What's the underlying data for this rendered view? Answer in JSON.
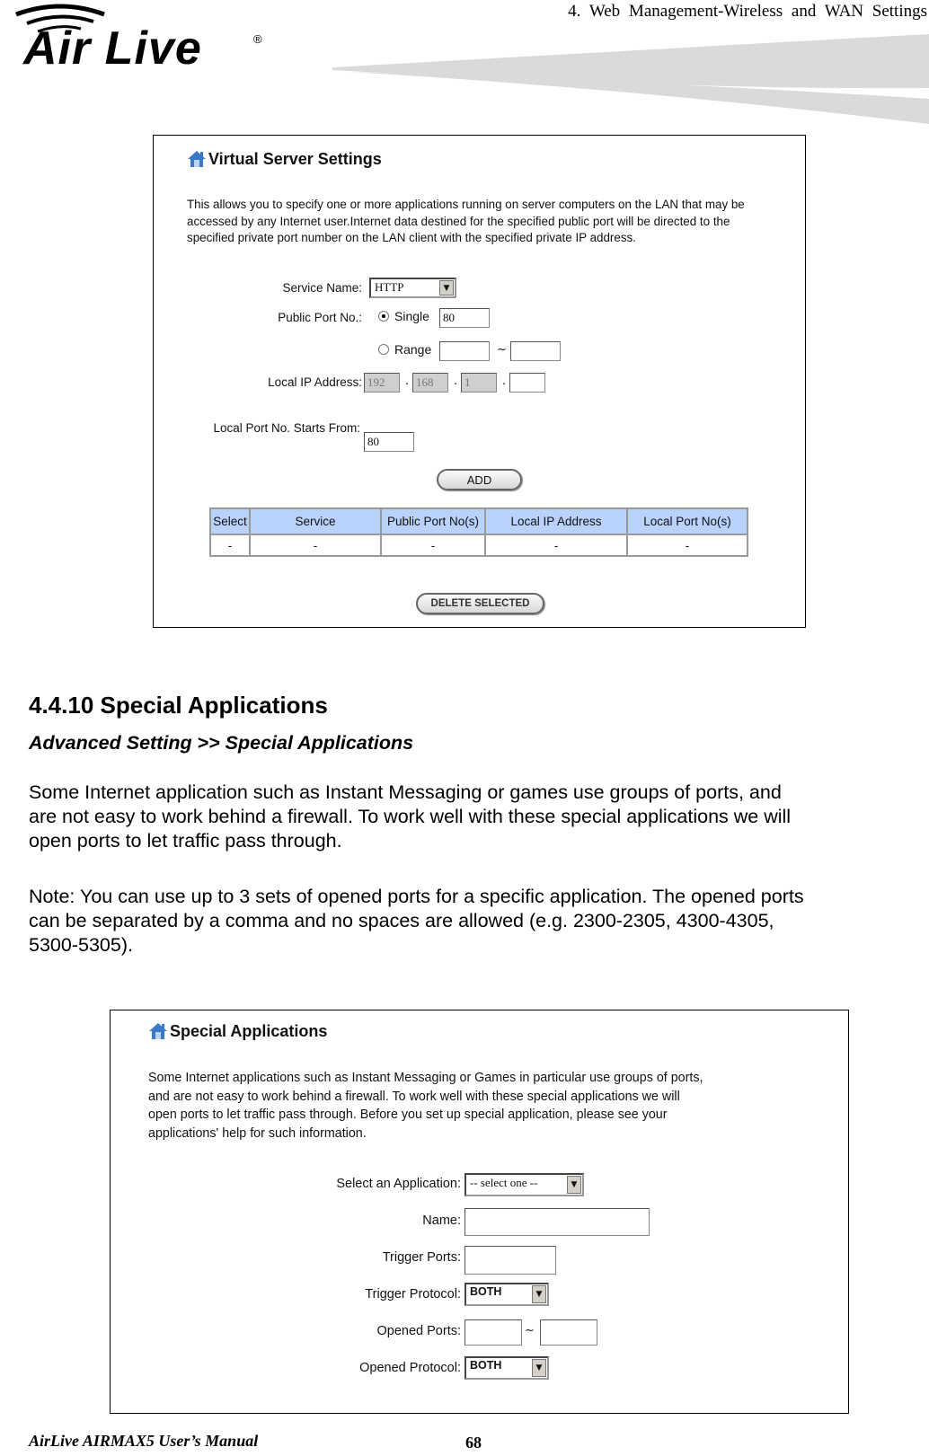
{
  "header": {
    "chapter_title": "4. Web Management-Wireless and WAN Settings",
    "logo_text": "Air Live",
    "logo_registered": "®"
  },
  "virtual_server": {
    "title": "Virtual Server Settings",
    "description": "This allows you to specify one or more applications running on server computers on the LAN that may be accessed by any Internet user.Internet data destined for the specified public port will be directed to the specified private port number on the LAN client with the specified private IP address.",
    "service_name_label": "Service Name:",
    "service_name_value": "HTTP",
    "public_port_label": "Public Port No.:",
    "single_label": "Single",
    "single_value": "80",
    "range_label": "Range",
    "range_from": "",
    "range_sep": "~",
    "range_to": "",
    "local_ip_label": "Local IP Address:",
    "ip_octets": [
      "192",
      "168",
      "1",
      ""
    ],
    "ip_sep": ".",
    "local_port_label": "Local Port No. Starts From:",
    "local_port_value": "80",
    "add_button": "ADD",
    "table": {
      "headers": [
        "Select",
        "Service",
        "Public Port No(s)",
        "Local IP Address",
        "Local Port No(s)"
      ],
      "rows": [
        [
          "-",
          "-",
          "-",
          "-",
          "-"
        ]
      ]
    },
    "delete_button": "DELETE SELECTED"
  },
  "section": {
    "heading": "4.4.10 Special Applications",
    "breadcrumb": "Advanced Setting >> Special Applications",
    "para1_lines": [
      "Some Internet application such as Instant Messaging or games use groups of ports, and",
      "are not easy to work behind a firewall. To work well with these special applications we will",
      "open ports to let traffic pass through."
    ],
    "para2_lines": [
      "Note: You can use up to 3 sets of opened ports for a specific application. The opened ports",
      "can be separated by a comma and no spaces are allowed (e.g. 2300-2305, 4300-4305,",
      "5300-5305)."
    ]
  },
  "special_apps": {
    "title": "Special Applications",
    "description_lines": [
      "Some Internet applications such as Instant Messaging or Games in particular use groups of ports,",
      "and are not easy to work behind a firewall. To work well with these special applications we will",
      "open ports to let traffic pass through. Before you set up special application, please see your",
      "applications' help for such information."
    ],
    "select_app_label": "Select an Application:",
    "select_app_value": "-- select one --",
    "name_label": "Name:",
    "name_value": "",
    "trigger_ports_label": "Trigger Ports:",
    "trigger_ports_value": "",
    "trigger_protocol_label": "Trigger Protocol:",
    "trigger_protocol_value": "BOTH",
    "opened_ports_label": "Opened Ports:",
    "opened_ports_from": "",
    "opened_ports_sep": "~",
    "opened_ports_to": "",
    "opened_protocol_label": "Opened Protocol:",
    "opened_protocol_value": "BOTH"
  },
  "footer": {
    "manual": "AirLive AIRMAX5 User’s Manual",
    "page": "68"
  }
}
